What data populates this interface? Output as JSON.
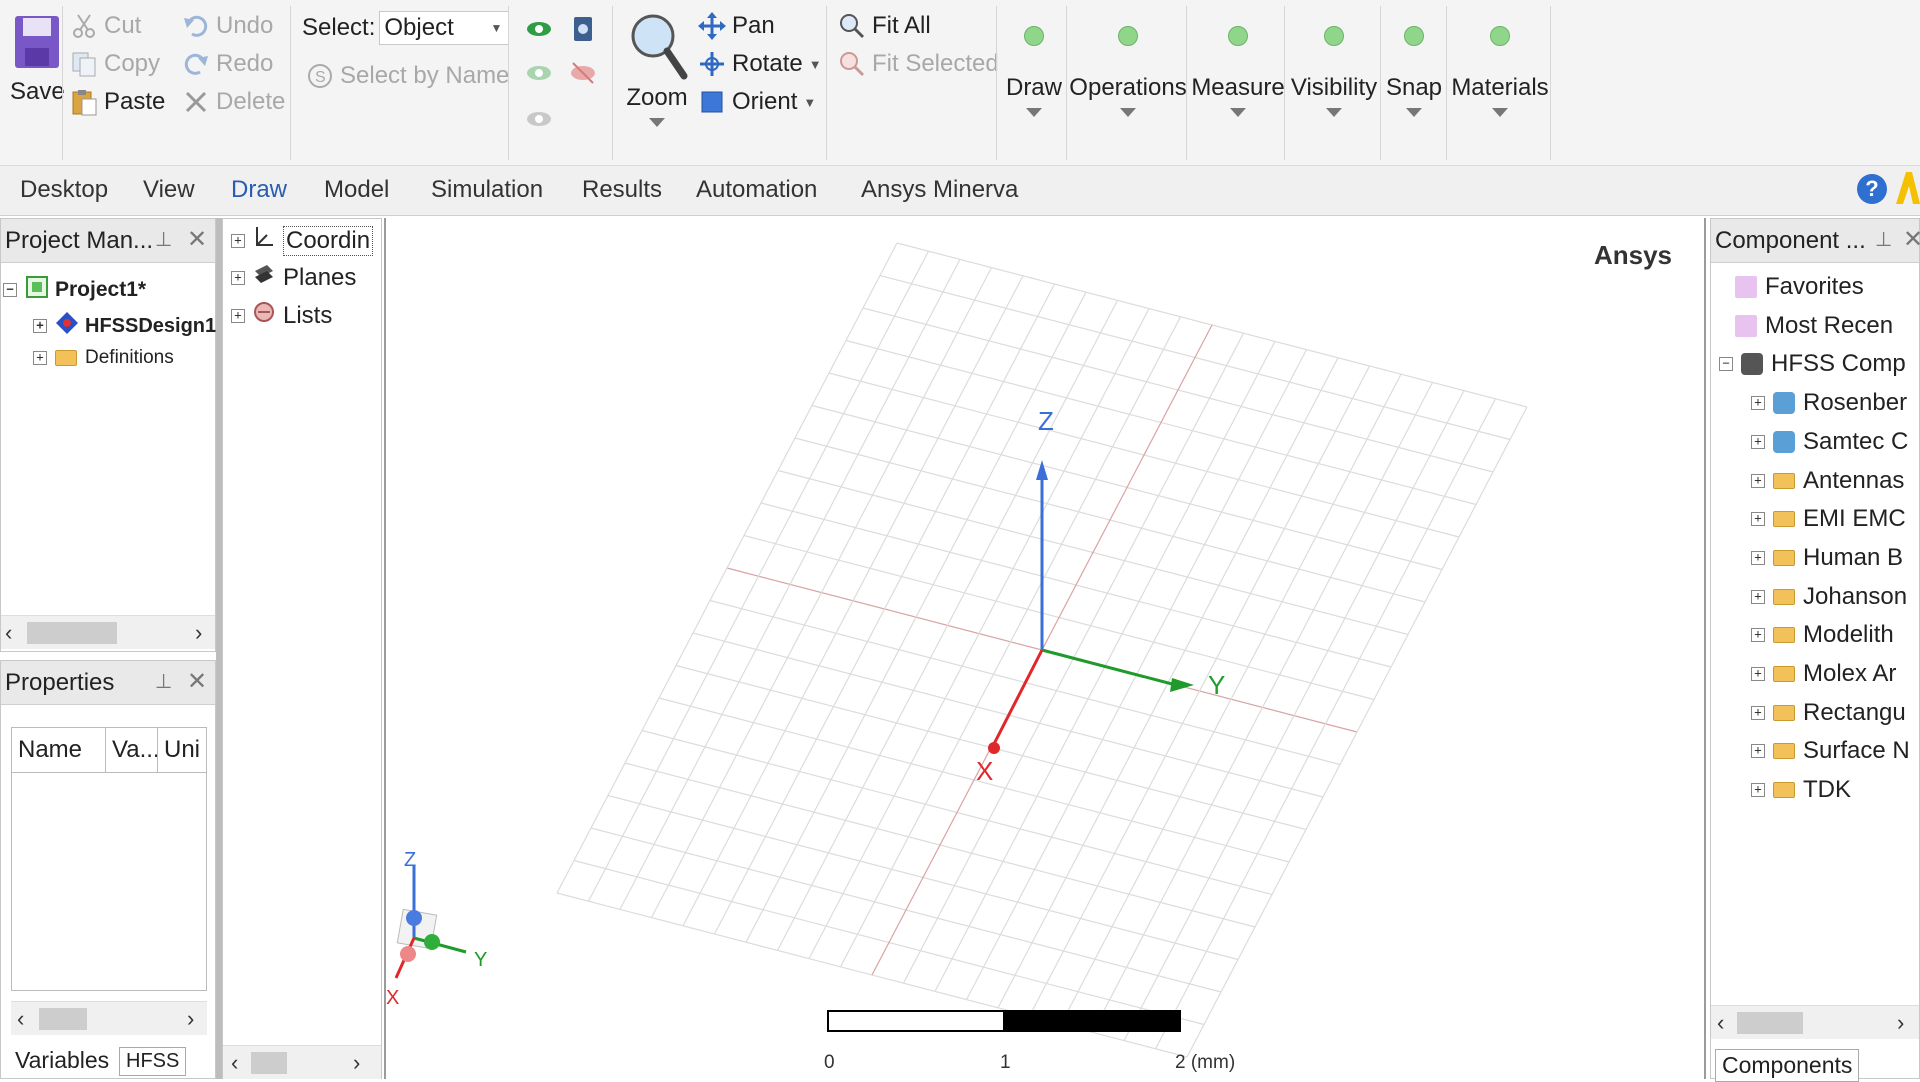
{
  "ribbon": {
    "save": "Save",
    "cut": "Cut",
    "copy": "Copy",
    "paste": "Paste",
    "undo": "Undo",
    "redo": "Redo",
    "delete": "Delete",
    "select_label": "Select:",
    "select_value": "Object",
    "select_by_name": "Select by Name",
    "zoom": "Zoom",
    "pan": "Pan",
    "rotate": "Rotate",
    "orient": "Orient",
    "fit_all": "Fit All",
    "fit_selected": "Fit Selected",
    "draw": "Draw",
    "operations": "Operations",
    "measure": "Measure",
    "visibility": "Visibility",
    "snap": "Snap",
    "materials": "Materials"
  },
  "tabs": [
    "Desktop",
    "View",
    "Draw",
    "Model",
    "Simulation",
    "Results",
    "Automation",
    "Ansys Minerva"
  ],
  "active_tab": "Draw",
  "help_glyph": "?",
  "project_manager": {
    "title": "Project Man...",
    "items": [
      "Project1*",
      "HFSSDesign1",
      "Definitions"
    ]
  },
  "properties": {
    "title": "Properties",
    "columns": [
      "Name",
      "Va...",
      "Uni"
    ],
    "tabs": [
      "Variables",
      "HFSS"
    ]
  },
  "model_tree": {
    "items": [
      "Coordin",
      "Planes",
      "Lists"
    ]
  },
  "viewport": {
    "watermark": "Ansys",
    "axis_x": "X",
    "axis_y": "Y",
    "axis_z": "Z",
    "scale_labels": [
      "0",
      "1",
      "2 (mm)"
    ]
  },
  "components": {
    "title": "Component ...",
    "items": [
      "Favorites",
      "Most Recen",
      "HFSS Comp",
      "Rosenber",
      "Samtec C",
      "Antennas",
      "EMI EMC",
      "Human B",
      "Johanson",
      "Modelith",
      "Molex Ar",
      "Rectangu",
      "Surface N",
      "TDK"
    ],
    "tab": "Components"
  },
  "colors": {
    "axis_x": "#e0282a",
    "axis_y": "#1f9a2b",
    "axis_z": "#3a6fd8",
    "accent_tab": "#2a5db0",
    "ansys_yellow": "#f5c000"
  }
}
